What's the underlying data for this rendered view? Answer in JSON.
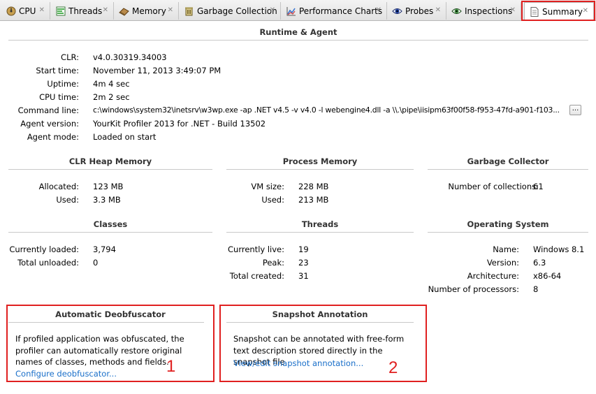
{
  "tabs": [
    {
      "label": "CPU",
      "icon": "cpu-icon"
    },
    {
      "label": "Threads",
      "icon": "threads-icon"
    },
    {
      "label": "Memory",
      "icon": "memory-icon"
    },
    {
      "label": "Garbage Collection",
      "icon": "trash-icon"
    },
    {
      "label": "Performance Charts",
      "icon": "chart-icon"
    },
    {
      "label": "Probes",
      "icon": "eye-icon"
    },
    {
      "label": "Inspections",
      "icon": "eye-icon"
    },
    {
      "label": "Summary",
      "icon": "document-icon",
      "active": true
    }
  ],
  "runtime": {
    "title": "Runtime & Agent",
    "rows": [
      {
        "label": "CLR:",
        "value": "v4.0.30319.34003"
      },
      {
        "label": "Start time:",
        "value": "November 11, 2013 3:49:07 PM"
      },
      {
        "label": "Uptime:",
        "value": "4m 4 sec"
      },
      {
        "label": "CPU time:",
        "value": "2m 2 sec"
      },
      {
        "label": "Command line:",
        "value": "c:\\windows\\system32\\inetsrv\\w3wp.exe -ap .NET v4.5 -v v4.0 -l webengine4.dll -a \\\\.\\pipe\\iisipm63f00f58-f953-47fd-a901-f103..."
      },
      {
        "label": "Agent version:",
        "value": "YourKit Profiler 2013 for .NET - Build 13502"
      },
      {
        "label": "Agent mode:",
        "value": "Loaded on start"
      }
    ],
    "more_button": "..."
  },
  "clr_heap": {
    "title": "CLR Heap Memory",
    "rows": [
      {
        "label": "Allocated:",
        "value": "123 MB"
      },
      {
        "label": "Used:",
        "value": "3.3 MB"
      }
    ]
  },
  "process_memory": {
    "title": "Process Memory",
    "rows": [
      {
        "label": "VM size:",
        "value": "228 MB"
      },
      {
        "label": "Used:",
        "value": "213 MB"
      }
    ]
  },
  "gc": {
    "title": "Garbage Collector",
    "rows": [
      {
        "label": "Number of collections:",
        "value": "61"
      }
    ]
  },
  "classes": {
    "title": "Classes",
    "rows": [
      {
        "label": "Currently loaded:",
        "value": "3,794"
      },
      {
        "label": "Total unloaded:",
        "value": "0"
      }
    ]
  },
  "threads": {
    "title": "Threads",
    "rows": [
      {
        "label": "Currently live:",
        "value": "19"
      },
      {
        "label": "Peak:",
        "value": "23"
      },
      {
        "label": "Total created:",
        "value": "31"
      }
    ]
  },
  "os": {
    "title": "Operating System",
    "rows": [
      {
        "label": "Name:",
        "value": "Windows 8.1"
      },
      {
        "label": "Version:",
        "value": "6.3"
      },
      {
        "label": "Architecture:",
        "value": "x86-64"
      },
      {
        "label": "Number of processors:",
        "value": "8"
      }
    ]
  },
  "deobfuscator": {
    "title": "Automatic Deobfuscator",
    "text": "If profiled application was obfuscated, the profiler can automatically restore original names of classes, methods and fields.",
    "link": "Configure deobfuscator...",
    "marker": "1"
  },
  "annotation": {
    "title": "Snapshot Annotation",
    "text": "Snapshot can be annotated with free-form text description stored directly in the snapshot file",
    "link": "View/edit snapshot annotation...",
    "marker": "2"
  },
  "colors": {
    "highlight": "#e02020",
    "link": "#1a6fc9"
  }
}
